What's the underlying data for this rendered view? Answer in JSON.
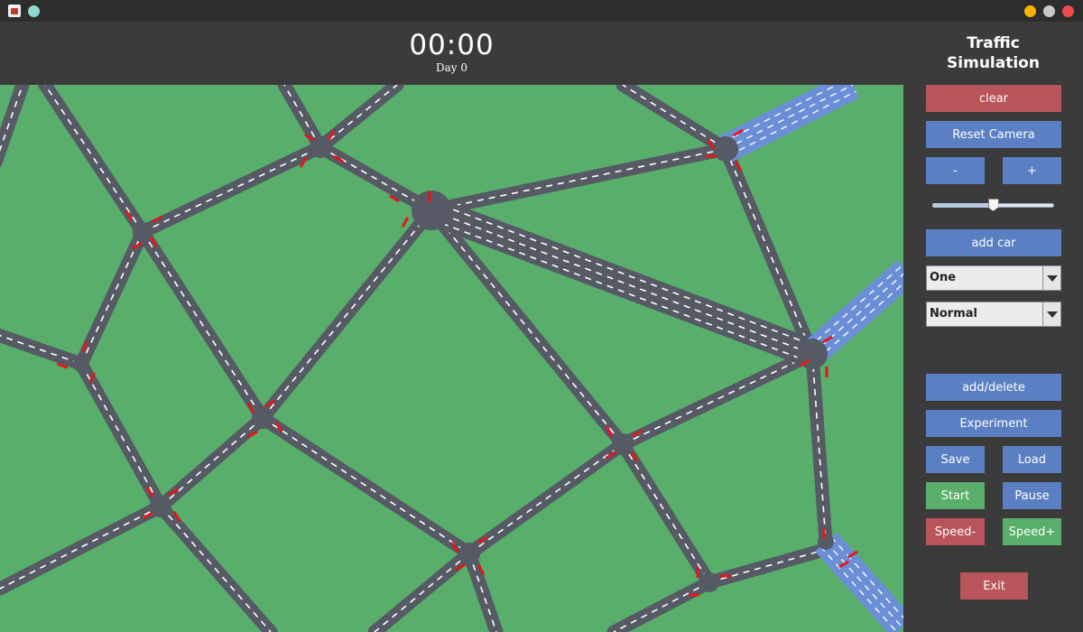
{
  "window": {
    "controls": [
      "minimize",
      "maximize",
      "close"
    ]
  },
  "header": {
    "clock": "00:00",
    "day": "Day 0"
  },
  "panel": {
    "title": "Traffic\nSimulation",
    "clear_label": "clear",
    "reset_camera_label": "Reset Camera",
    "zoom_out_label": "-",
    "zoom_in_label": "+",
    "zoom_level": 0.5,
    "add_car_label": "add car",
    "lane_select_value": "One",
    "mode_select_value": "Normal",
    "add_delete_label": "add/delete",
    "experiment_label": "Experiment",
    "save_label": "Save",
    "load_label": "Load",
    "start_label": "Start",
    "pause_label": "Pause",
    "speed_down_label": "Speed-",
    "speed_up_label": "Speed+",
    "exit_label": "Exit"
  },
  "colors": {
    "grass": "#58ae6a",
    "road": "#555a65",
    "lane_marking": "#ffffff",
    "highway": "#6b8fd6",
    "traffic_light": "#e3171a",
    "button_blue": "#5a7fc3",
    "button_red": "#b8545a",
    "button_green": "#58ae6a"
  }
}
